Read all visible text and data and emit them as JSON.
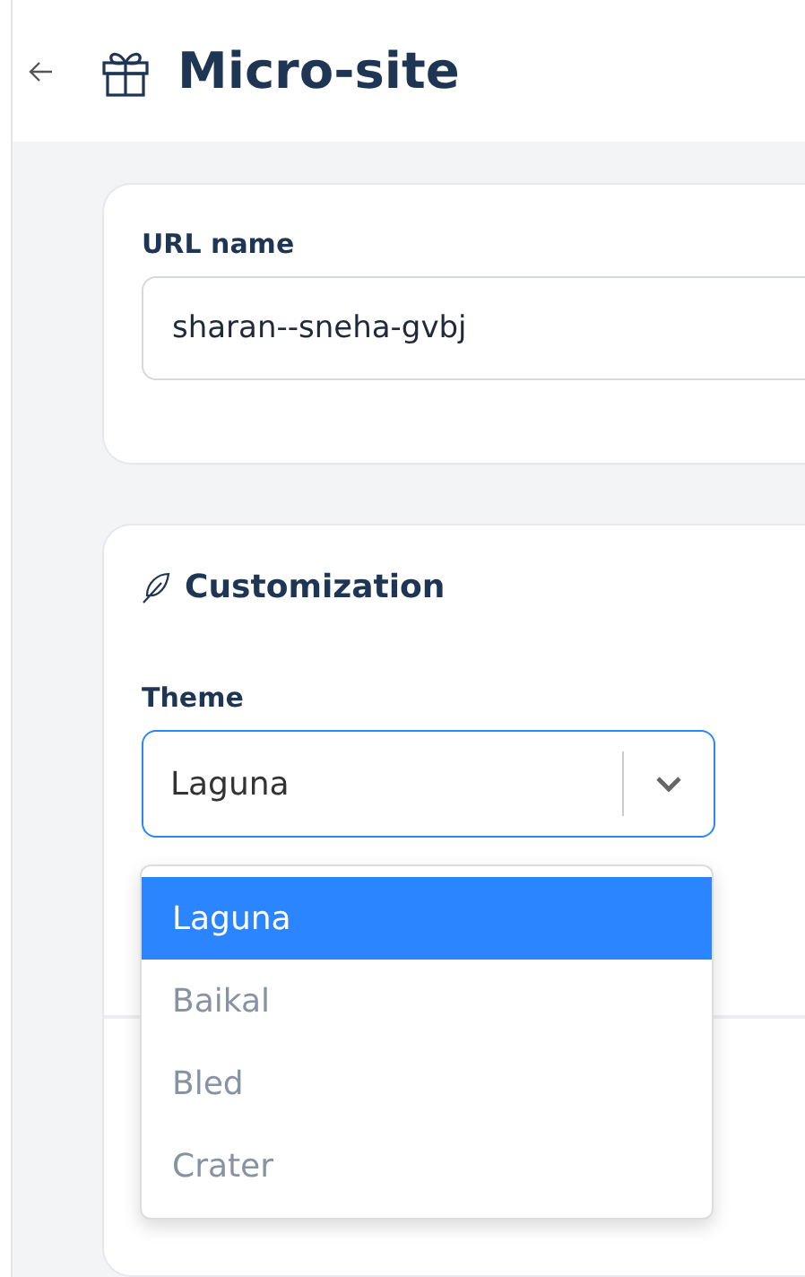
{
  "header": {
    "title": "Micro-site"
  },
  "url_card": {
    "label": "URL name",
    "value": "sharan--sneha-gvbj"
  },
  "customization": {
    "title": "Customization",
    "theme_label": "Theme",
    "theme_value": "Laguna",
    "options": [
      {
        "label": "Laguna",
        "selected": true
      },
      {
        "label": "Baikal",
        "selected": false
      },
      {
        "label": "Bled",
        "selected": false
      },
      {
        "label": "Crater",
        "selected": false
      }
    ]
  }
}
